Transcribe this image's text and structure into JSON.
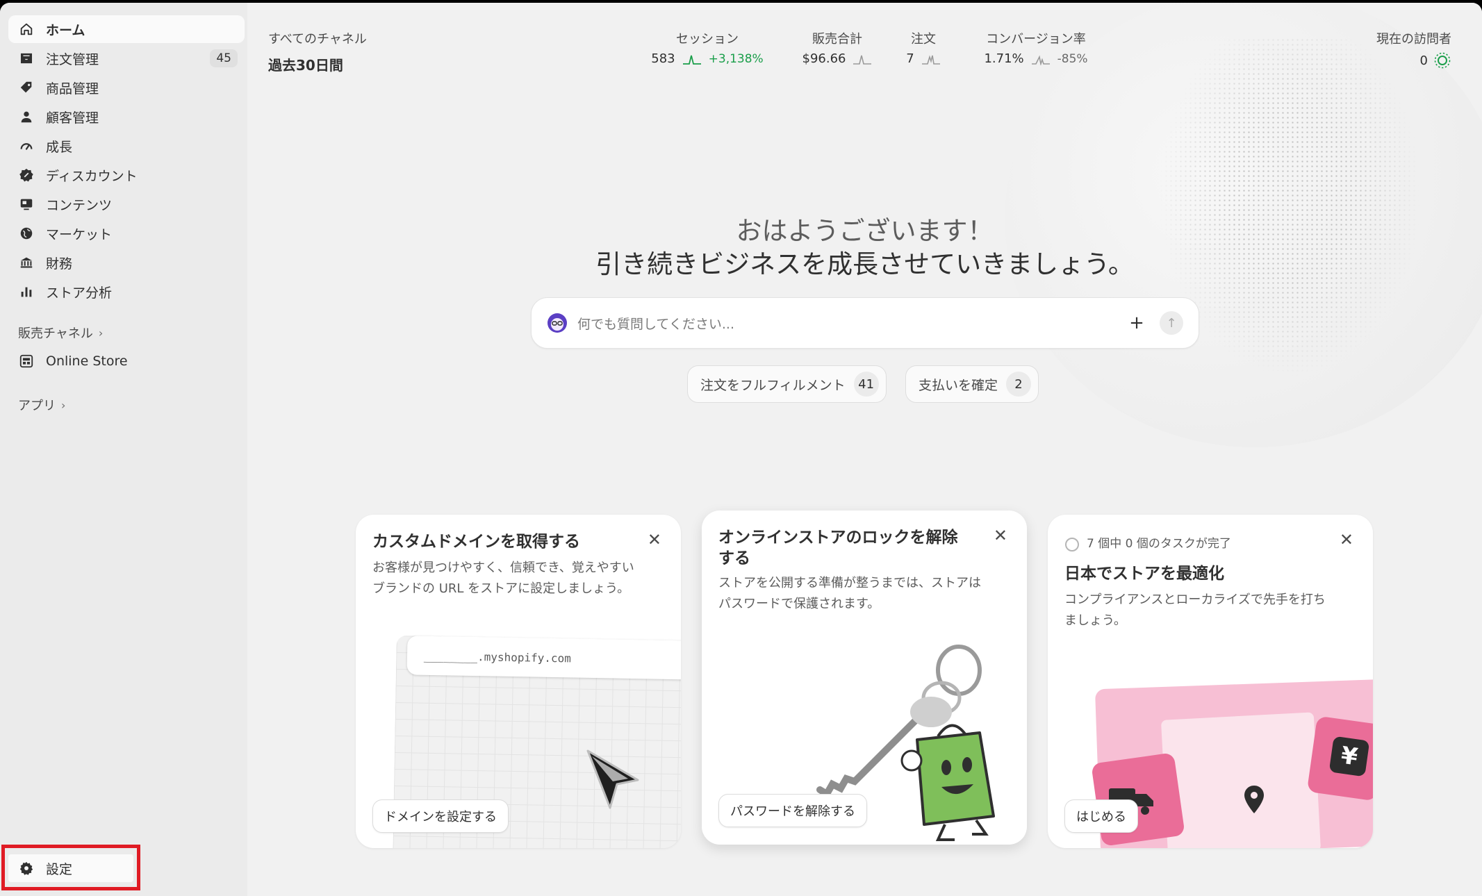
{
  "sidebar": {
    "items": [
      {
        "label": "ホーム"
      },
      {
        "label": "注文管理",
        "badge": "45"
      },
      {
        "label": "商品管理"
      },
      {
        "label": "顧客管理"
      },
      {
        "label": "成長"
      },
      {
        "label": "ディスカウント"
      },
      {
        "label": "コンテンツ"
      },
      {
        "label": "マーケット"
      },
      {
        "label": "財務"
      },
      {
        "label": "ストア分析"
      }
    ],
    "sales_channels_label": "販売チャネル",
    "online_store_label": "Online Store",
    "apps_label": "アプリ",
    "settings_label": "設定"
  },
  "header": {
    "channel_filter": "すべてのチャネル",
    "date_range": "過去30日間",
    "metrics": [
      {
        "label": "セッション",
        "value": "583",
        "delta": "+3,138%",
        "delta_color": "#1a9e4a"
      },
      {
        "label": "販売合計",
        "value": "$96.66",
        "delta": ""
      },
      {
        "label": "注文",
        "value": "7",
        "delta": ""
      },
      {
        "label": "コンバージョン率",
        "value": "1.71%",
        "delta": "-85%",
        "delta_color": "#6a6a6a"
      }
    ],
    "visitors": {
      "label": "現在の訪問者",
      "value": "0"
    }
  },
  "greeting": {
    "line1": "おはようございます！",
    "line2": "引き続きビジネスを成長させていきましょう。"
  },
  "search": {
    "placeholder": "何でも質問してください..."
  },
  "quick_actions": [
    {
      "label": "注文をフルフィルメント",
      "count": "41"
    },
    {
      "label": "支払いを確定",
      "count": "2"
    }
  ],
  "cards": [
    {
      "title": "カスタムドメインを取得する",
      "body_line1": "お客様が見つけやすく、信頼でき、覚えやすい",
      "body_line2": "ブランドの URL をストアに設定しましょう。",
      "url_text": "________.myshopify.com",
      "button": "ドメインを設定する"
    },
    {
      "title_line1": "オンラインストアのロックを解除",
      "title_line2": "する",
      "body_line1": "ストアを公開する準備が整うまでは、ストアは",
      "body_line2": "パスワードで保護されます。",
      "button": "パスワードを解除する"
    },
    {
      "progress": "7 個中 0 個のタスクが完了",
      "title": "日本でストアを最適化",
      "body_line1": "コンプライアンスとローカライズで先手を打ち",
      "body_line2": "ましょう。",
      "button": "はじめる"
    }
  ],
  "colors": {
    "highlight": "#e01b24",
    "accent_green": "#1a9e4a",
    "pink": "#ea6d98"
  }
}
